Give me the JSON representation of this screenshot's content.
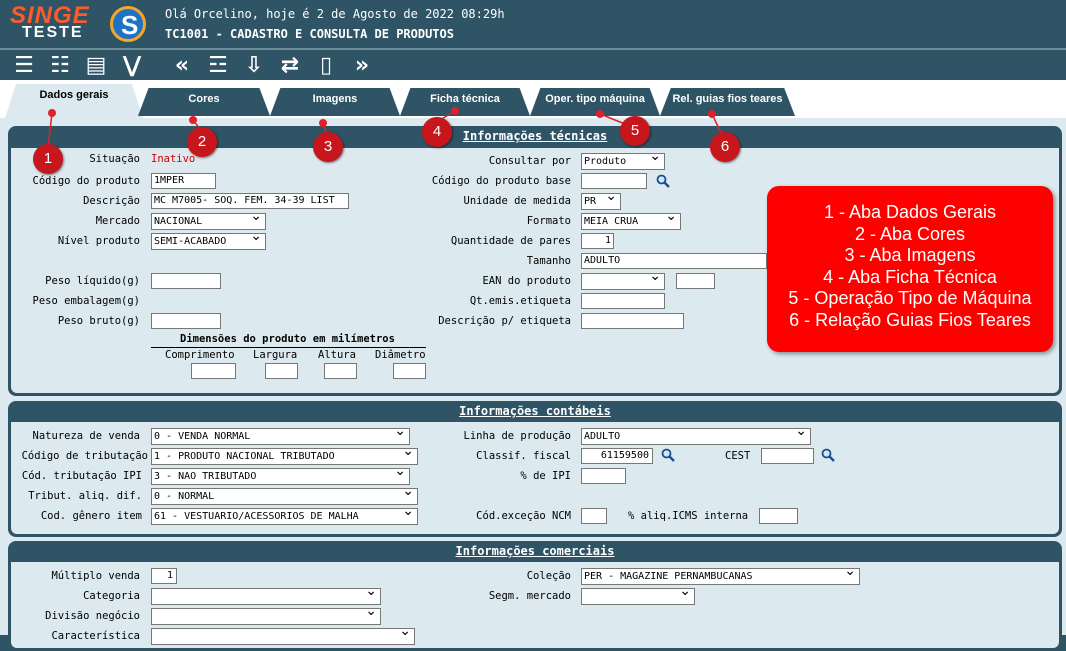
{
  "header": {
    "logo_top": "SINGE",
    "logo_bottom": "TESTE",
    "greeting": "Olá Orcelino, hoje é 2 de Agosto de 2022 08:29h",
    "screen_title": "TC1001 - CADASTRO E CONSULTA DE PRODUTOS"
  },
  "tabs": [
    "Dados gerais",
    "Cores",
    "Imagens",
    "Ficha técnica",
    "Oper. tipo máquina",
    "Rel. guias fios teares"
  ],
  "markers": [
    "1",
    "2",
    "3",
    "4",
    "5",
    "6"
  ],
  "legend": [
    "1 - Aba Dados Gerais",
    "2 - Aba Cores",
    "3 - Aba Imagens",
    "4 - Aba Ficha Técnica",
    "5 - Operação Tipo de Máquina",
    "6 - Relação Guias Fios Teares"
  ],
  "tecnicas": {
    "title": "Informações técnicas",
    "situacao_label": "Situação",
    "situacao_value": "Inativo",
    "codigo_label": "Código do produto",
    "codigo_value": "1MPER",
    "descricao_label": "Descrição",
    "descricao_value": "MC M7005- SOQ. FEM. 34-39 LIST",
    "mercado_label": "Mercado",
    "mercado_value": "NACIONAL",
    "nivel_label": "Nível produto",
    "nivel_value": "SEMI-ACABADO",
    "peso_liq_label": "Peso líquido(g)",
    "peso_emb_label": "Peso embalagem(g)",
    "peso_bruto_label": "Peso bruto(g)",
    "dim_title": "Dimensões do produto em milímetros",
    "dim_labels": [
      "Comprimento",
      "Largura",
      "Altura",
      "Diâmetro"
    ],
    "consultar_label": "Consultar por",
    "consultar_value": "Produto",
    "codbase_label": "Código do produto base",
    "unidade_label": "Unidade de medida",
    "unidade_value": "PR",
    "formato_label": "Formato",
    "formato_value": "MEIA CRUA",
    "qtd_label": "Quantidade de pares",
    "qtd_value": "1",
    "tamanho_label": "Tamanho",
    "tamanho_value": "ADULTO",
    "ean_label": "EAN do produto",
    "qtemis_label": "Qt.emis.etiqueta",
    "desc_etiq_label": "Descrição p/ etiqueta"
  },
  "contabeis": {
    "title": "Informações contábeis",
    "natureza_label": "Natureza de venda",
    "natureza_value": "0 - VENDA NORMAL",
    "tributacao_label": "Código de tributação",
    "tributacao_value": "1 - PRODUTO NACIONAL TRIBUTADO",
    "ipi_label": "Cód. tributação IPI",
    "ipi_value": "3 - NAO TRIBUTADO",
    "aliq_label": "Tribut. aliq. dif.",
    "aliq_value": "0 - NORMAL",
    "genero_label": "Cod. gênero item",
    "genero_value": "61 - VESTUARIO/ACESSORIOS DE MALHA",
    "linha_label": "Linha de produção",
    "linha_value": "ADULTO",
    "classif_label": "Classif. fiscal",
    "classif_value": "61159500",
    "cest_label": "CEST",
    "pct_ipi_label": "% de IPI",
    "excecao_label": "Cód.exceção NCM",
    "icms_label": "% aliq.ICMS interna"
  },
  "comerciais": {
    "title": "Informações comerciais",
    "multiplo_label": "Múltiplo venda",
    "multiplo_value": "1",
    "categoria_label": "Categoria",
    "divisao_label": "Divisão negócio",
    "caracteristica_label": "Característica",
    "colecao_label": "Coleção",
    "colecao_value": "PER - MAGAZINE PERNAMBUCANAS",
    "segm_label": "Segm. mercado"
  }
}
